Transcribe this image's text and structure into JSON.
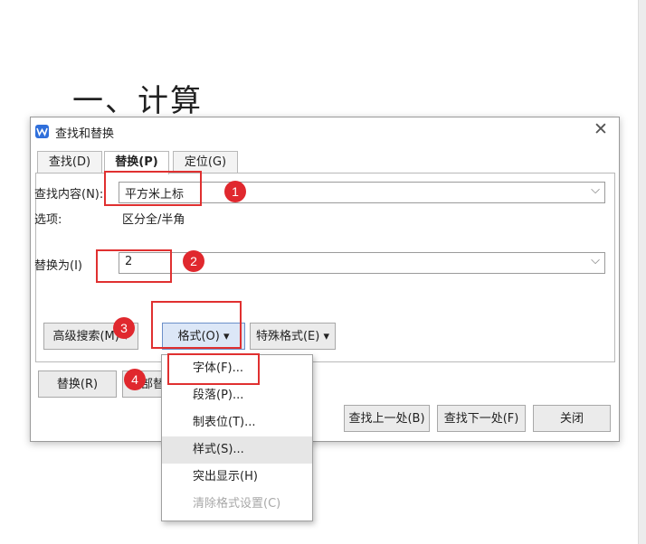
{
  "document": {
    "heading": "一、计算"
  },
  "dialog": {
    "title": "查找和替换",
    "tabs": [
      {
        "label": "查找(D)"
      },
      {
        "label": "替换(P)"
      },
      {
        "label": "定位(G)"
      }
    ],
    "find_label": "查找内容(N):",
    "find_value": "平方米上标",
    "options_label": "选项:",
    "options_value": "区分全/半角",
    "replace_label": "替换为(I)",
    "replace_value": "2",
    "buttons": {
      "advanced_search": "高级搜索(M) ▾",
      "format": "格式(O) ▾",
      "special_format": "特殊格式(E) ▾",
      "replace": "替换(R)",
      "replace_all": "全部替换(A)",
      "find_prev": "查找上一处(B)",
      "find_next": "查找下一处(F)",
      "close": "关闭"
    }
  },
  "format_menu": [
    {
      "label": "字体(F)..."
    },
    {
      "label": "段落(P)..."
    },
    {
      "label": "制表位(T)..."
    },
    {
      "label": "样式(S)..."
    },
    {
      "label": "突出显示(H)"
    },
    {
      "label": "清除格式设置(C)"
    }
  ],
  "annotations": {
    "badges": [
      "1",
      "2",
      "3",
      "4"
    ],
    "color": "#e0282e"
  },
  "colors": {
    "accent": "#2f6fdb",
    "highlight": "#e03030"
  }
}
